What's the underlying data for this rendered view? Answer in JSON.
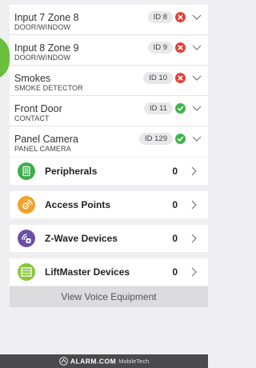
{
  "zones": [
    {
      "name": "Input 7 Zone 8",
      "type": "DOOR/WINDOW",
      "id": "ID 8",
      "status": "fault",
      "status_icon": "x-circle-icon"
    },
    {
      "name": "Input 8 Zone 9",
      "type": "DOOR/WINDOW",
      "id": "ID 9",
      "status": "fault",
      "status_icon": "x-circle-icon"
    },
    {
      "name": "Smokes",
      "type": "SMOKE DETECTOR",
      "id": "ID 10",
      "status": "fault",
      "status_icon": "x-circle-icon"
    },
    {
      "name": "Front Door",
      "type": "CONTACT",
      "id": "ID 11",
      "status": "ok",
      "status_icon": "check-circle-icon"
    },
    {
      "name": "Panel Camera",
      "type": "PANEL CAMERA",
      "id": "ID 129",
      "status": "ok",
      "status_icon": "check-circle-icon"
    }
  ],
  "device_groups": [
    {
      "label": "Peripherals",
      "count": "0",
      "icon": "keypad-icon",
      "color": "#3dae49"
    },
    {
      "label": "Access Points",
      "count": "0",
      "icon": "access-point-icon",
      "color": "#f1a22a"
    },
    {
      "label": "Z-Wave Devices",
      "count": "0",
      "icon": "z-wave-icon",
      "color": "#6a4fa3"
    },
    {
      "label": "LiftMaster Devices",
      "count": "0",
      "icon": "garage-door-icon",
      "color": "#8cc63f"
    }
  ],
  "voice_button": {
    "label": "View Voice Equipment"
  },
  "footer": {
    "brand": "ALARM.COM",
    "tagline": "MobileTech"
  },
  "colors": {
    "fault": "#e0413a",
    "ok": "#40b54a",
    "accent_tab": "#6cbf3a",
    "footer_bg": "#4a4a4d"
  }
}
